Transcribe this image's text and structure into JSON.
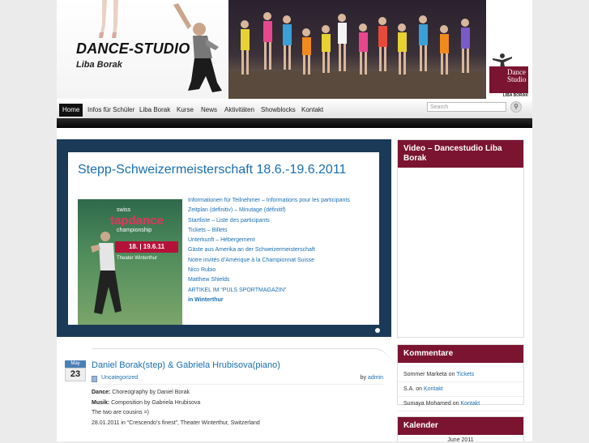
{
  "header": {
    "title": "DANCE-STUDIO",
    "subtitle": "Liba Borak",
    "side_logo_line1": "Dance",
    "side_logo_line2": "Studio",
    "side_logo_name": "LIBA BORAK"
  },
  "nav": {
    "items": [
      "Home",
      "Infos für Schüler",
      "Liba Borak",
      "Kurse",
      "News",
      "Aktivitäten",
      "Showblocks",
      "Kontakt"
    ],
    "search_placeholder": "Search"
  },
  "featured": {
    "title": "Stepp-Schweizermeisterschaft 18.6.-19.6.2011",
    "poster": {
      "swiss": "swiss",
      "tapdance": "tapdance",
      "championship": "championship",
      "dates": "18. | 19.6.11",
      "theater": "Theater Winterthur"
    },
    "links": [
      "Informationen für Teilnehmer – Informations pour les participants",
      "Zeitplan (definitiv) – Minutage (définitif)",
      "Startliste – Liste des participants",
      "Tickets – Billets",
      "Unterkunft – Hébergement",
      "Gäste aus Amerika an der Schweizermeisterschaft",
      "Notre invités d’Amérique à la Championnat Suisse",
      "Nico Rubio",
      "Matthew Shields",
      "ARTIKEL IM “PULS SPORTMAGAZIN”",
      "in Winterthur"
    ]
  },
  "post": {
    "month": "May",
    "day": "23",
    "title": "Daniel Borak(step) & Gabriela Hrubisova(piano)",
    "category": "Uncategorized",
    "by_label": "by",
    "author": "admin",
    "dance_label": "Dance:",
    "dance_value": "Choreography by Daniel Borak",
    "music_label": "Musik:",
    "music_value": "Composition by Gabriela Hrubisova",
    "line3": "The two are cousins =)",
    "line4": "28.01.2011 in “Crescendo’s finest”, Theater Winterthur, Switzerland"
  },
  "sidebar": {
    "video_title": "Video – Dancestudio Liba Borak",
    "comments_title": "Kommentare",
    "comments": [
      {
        "author": "Sommer Marketa",
        "on": "on",
        "target": "Tickets"
      },
      {
        "author": "S.A.",
        "on": "on",
        "target": "Kontakt"
      },
      {
        "author": "Sumaya Mohamed",
        "on": "on",
        "target": "Kontakt"
      }
    ],
    "calendar_title": "Kalender",
    "calendar_month": "June 2011"
  },
  "colors": {
    "accent": "#7b1431",
    "link": "#1a6fb0",
    "featured_bg": "#1b3a58"
  }
}
